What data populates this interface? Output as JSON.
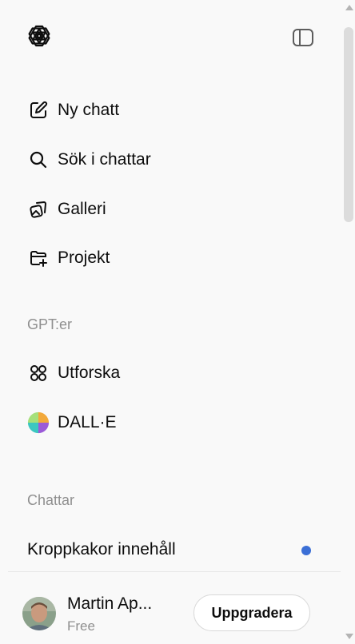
{
  "header": {
    "logo_icon": "openai-logo-icon",
    "toggle_icon": "sidebar-toggle-icon"
  },
  "nav": {
    "items": [
      {
        "label": "Ny chatt",
        "icon": "pencil-square-icon"
      },
      {
        "label": "Sök i chattar",
        "icon": "search-icon"
      },
      {
        "label": "Galleri",
        "icon": "gallery-icon"
      },
      {
        "label": "Projekt",
        "icon": "folder-plus-icon"
      }
    ]
  },
  "gpts": {
    "section_title": "GPT:er",
    "items": [
      {
        "label": "Utforska",
        "icon": "grid-circles-icon"
      },
      {
        "label": "DALL·E",
        "icon": "dalle-avatar-icon"
      }
    ]
  },
  "chats": {
    "section_title": "Chattar",
    "items": [
      {
        "label": "Kroppkakor innehåll",
        "unread": true
      }
    ]
  },
  "user": {
    "name": "Martin Ap...",
    "plan": "Free",
    "upgrade_label": "Uppgradera"
  },
  "colors": {
    "background": "#f9f9f9",
    "text": "#0d0d0d",
    "muted": "#8f8f8f",
    "unread_dot": "#3b6fd6"
  }
}
